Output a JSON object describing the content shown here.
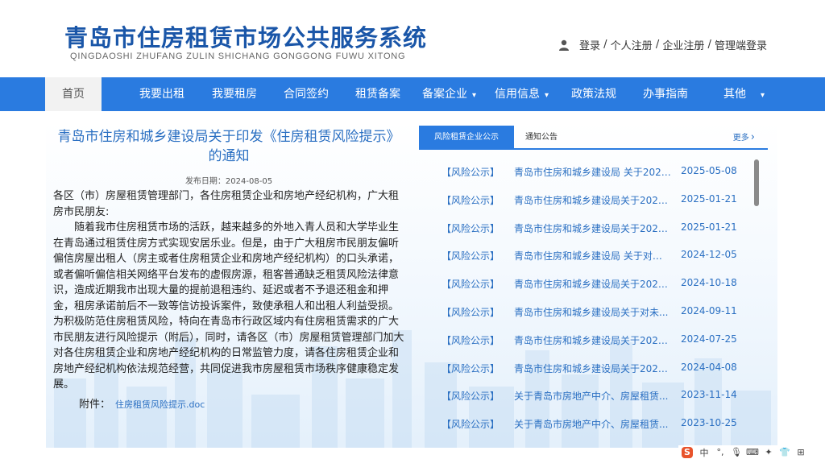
{
  "header": {
    "title_cn": "青岛市住房租赁市场公共服务系统",
    "title_en": "QINGDAOSHI ZHUFANG ZULIN SHICHANG GONGGONG FUWU XITONG",
    "user_links": [
      "登录",
      "个人注册",
      "企业注册",
      "管理端登录"
    ],
    "separator": " / "
  },
  "nav": {
    "items": [
      {
        "label": "首页"
      },
      {
        "label": "我要出租"
      },
      {
        "label": "我要租房"
      },
      {
        "label": "合同签约"
      },
      {
        "label": "租赁备案"
      },
      {
        "label": "备案企业"
      },
      {
        "label": "信用信息"
      },
      {
        "label": "政策法规"
      },
      {
        "label": "办事指南"
      },
      {
        "label": "其他"
      }
    ]
  },
  "article": {
    "title": "青岛市住房和城乡建设局关于印发《住房租赁风险提示》的通知",
    "publish_date": "发布日期：2024-08-05",
    "salutation": "各区（市）房屋租赁管理部门，各住房租赁企业和房地产经纪机构，广大租房市民朋友:",
    "body": "随着我市住房租赁市场的活跃，越来越多的外地入青人员和大学毕业生在青岛通过租赁住房方式实现安居乐业。但是，由于广大租房市民朋友偏听偏信房屋出租人（房主或者住房租赁企业和房地产经纪机构）的口头承诺，或者偏听偏信相关网络平台发布的虚假房源，租客普通缺乏租赁风险法律意识，造成近期我市出现大量的提前退租违约、延迟或者不予退还租金和押金，租房承诺前后不一致等信访投诉案件，致使承租人和出租人利益受损。为积极防范住房租赁风险，特向在青岛市行政区域内有住房租赁需求的广大市民朋友进行风险提示（附后），同时，请各区（市）房屋租赁管理部门加大对各住房租赁企业和房地产经纪机构的日常监管力度，请各住房租赁企业和房地产经纪机构依法规范经营，共同促进我市房屋租赁市场秩序健康稳定发展。",
    "attachment_label": "附件：",
    "attachment_file": "住房租赁风险提示.doc"
  },
  "notices": {
    "tab_active": "风险租赁企业公示",
    "tab_inactive": "通知公告",
    "more_label": "更多",
    "items": [
      {
        "tag": "【风险公示】",
        "title": "青岛市住房和城乡建设局 关于2025年...",
        "date": "2025-05-08"
      },
      {
        "tag": "【风险公示】",
        "title": "青岛市住房和城乡建设局关于2024年...",
        "date": "2025-01-21"
      },
      {
        "tag": "【风险公示】",
        "title": "青岛市住房和城乡建设局关于2024年...",
        "date": "2025-01-21"
      },
      {
        "tag": "【风险公示】",
        "title": "青岛市住房和城乡建设局 关于对未...",
        "date": "2024-12-05"
      },
      {
        "tag": "【风险公示】",
        "title": "青岛市住房和城乡建设局关于2024年...",
        "date": "2024-10-18"
      },
      {
        "tag": "【风险公示】",
        "title": "青岛市住房和城乡建设局关于对未...",
        "date": "2024-09-11"
      },
      {
        "tag": "【风险公示】",
        "title": "青岛市住房和城乡建设局关于2024年...",
        "date": "2024-07-25"
      },
      {
        "tag": "【风险公示】",
        "title": "青岛市住房和城乡建设局关于2024年...",
        "date": "2024-04-08"
      },
      {
        "tag": "【风险公示】",
        "title": "关于青岛市房地产中介、房屋租赁...",
        "date": "2023-11-14"
      },
      {
        "tag": "【风险公示】",
        "title": "关于青岛市房地产中介、房屋租赁...",
        "date": "2023-10-25"
      }
    ]
  },
  "ime_bar": {
    "logo": "S",
    "lang": "中"
  },
  "colors": {
    "brand_blue": "#2a7be0",
    "title_blue": "#1a56a8",
    "link_blue": "#2a6fc2"
  }
}
